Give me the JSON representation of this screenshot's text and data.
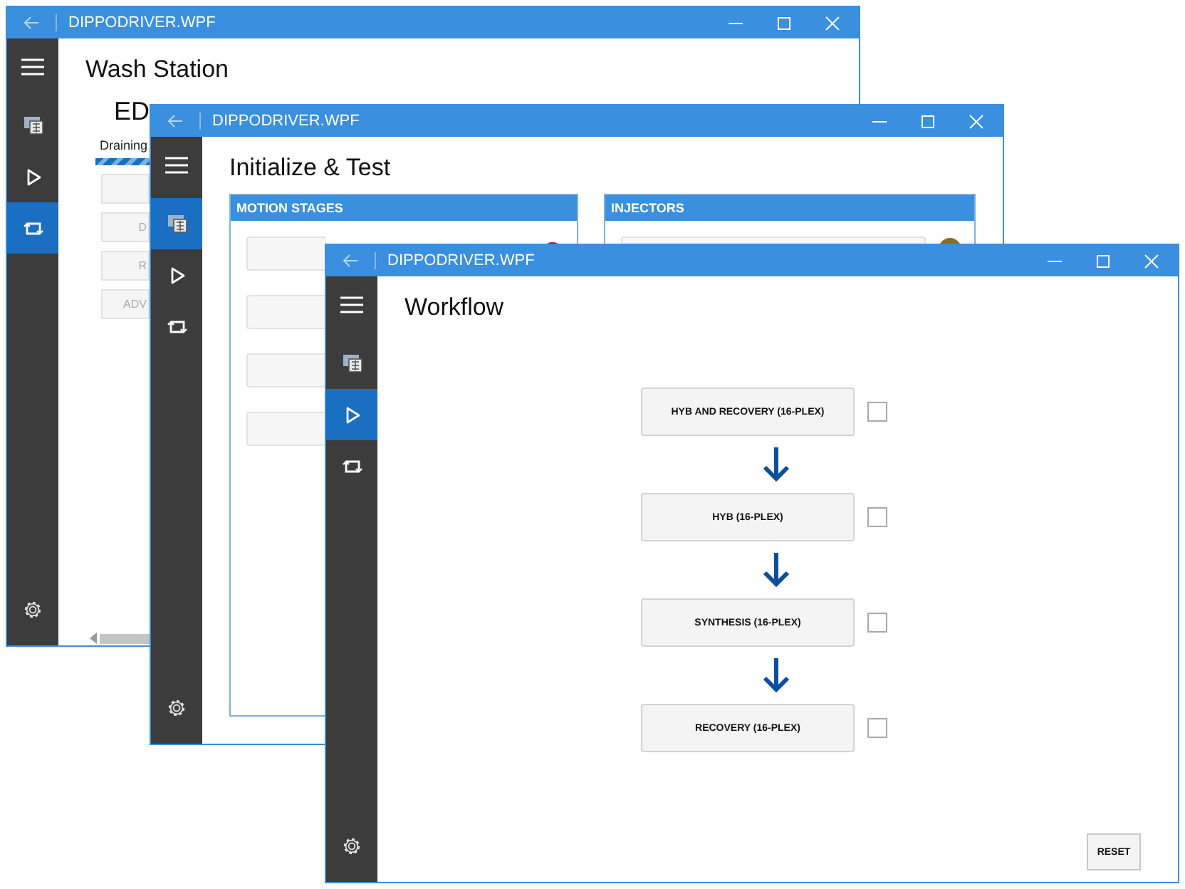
{
  "windows": [
    {
      "kind": "wash",
      "title": "DIPPODRIVER.WPF",
      "page_title": "Wash Station",
      "nav": [
        {
          "kind": "instrument",
          "selected": false
        },
        {
          "kind": "play",
          "selected": false
        },
        {
          "kind": "loop",
          "selected": true
        }
      ],
      "heading": "ED",
      "status": "Draining",
      "progress": {
        "level": 1
      },
      "buttons": [
        {
          "kind": "blank"
        },
        {
          "kind": "labelled",
          "label": "D"
        },
        {
          "kind": "labelled",
          "label": "R"
        },
        {
          "kind": "labelled",
          "label": "ADV"
        }
      ]
    },
    {
      "kind": "init",
      "title": "DIPPODRIVER.WPF",
      "page_title": "Initialize & Test",
      "nav": [
        {
          "kind": "instrument",
          "selected": true
        },
        {
          "kind": "play",
          "selected": false
        },
        {
          "kind": "loop",
          "selected": false
        }
      ],
      "panels": [
        {
          "title": "MOTION STAGES",
          "rows": [
            {
              "kind": "indicator",
              "color": "#a3171b"
            },
            {
              "kind": "plain"
            },
            {
              "kind": "plain"
            },
            {
              "kind": "plain"
            }
          ]
        },
        {
          "title": "INJECTORS",
          "rows": [
            {
              "kind": "indicator",
              "color": "#8a6d1e"
            }
          ]
        }
      ]
    },
    {
      "kind": "workflow",
      "title": "DIPPODRIVER.WPF",
      "page_title": "Workflow",
      "nav": [
        {
          "kind": "instrument",
          "selected": false
        },
        {
          "kind": "play",
          "selected": true
        },
        {
          "kind": "loop",
          "selected": false
        }
      ],
      "steps": [
        {
          "label": "HYB AND RECOVERY (16-PLEX)",
          "checked": false
        },
        {
          "label": "HYB (16-PLEX)",
          "checked": false
        },
        {
          "label": "SYNTHESIS (16-PLEX)",
          "checked": false
        },
        {
          "label": "RECOVERY (16-PLEX)",
          "checked": false
        }
      ],
      "reset_button": "RESET"
    }
  ]
}
